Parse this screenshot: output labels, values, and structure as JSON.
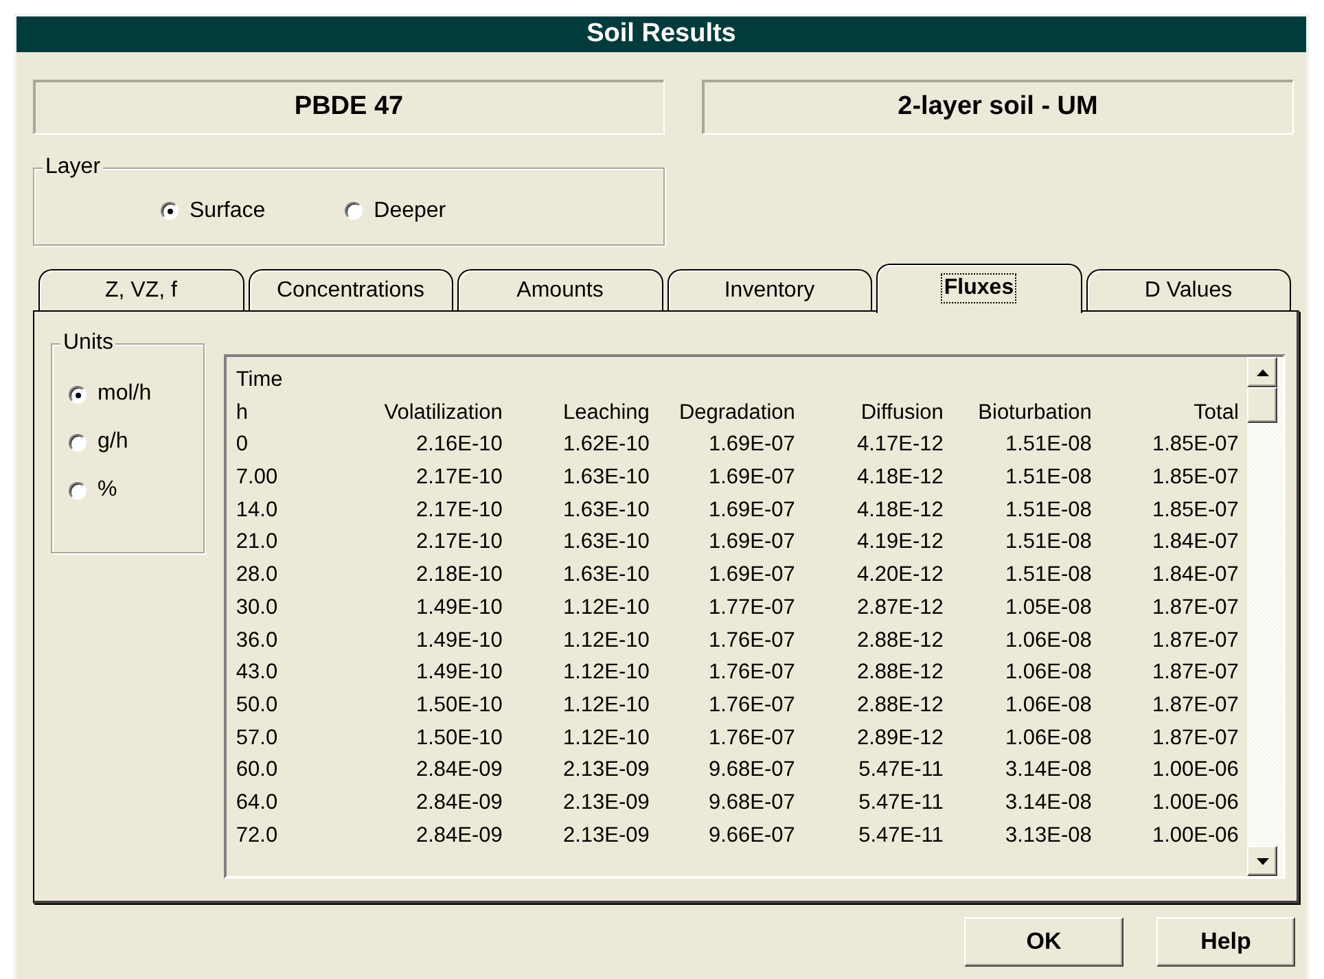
{
  "window": {
    "title": "Soil Results"
  },
  "chemical": "PBDE 47",
  "model": "2-layer soil - UM",
  "layer_group": {
    "label": "Layer",
    "options": [
      {
        "label": "Surface",
        "selected": true
      },
      {
        "label": "Deeper",
        "selected": false
      }
    ]
  },
  "tabs": [
    {
      "label": "Z, VZ, f",
      "selected": false
    },
    {
      "label": "Concentrations",
      "selected": false
    },
    {
      "label": "Amounts",
      "selected": false
    },
    {
      "label": "Inventory",
      "selected": false
    },
    {
      "label": "Fluxes",
      "selected": true
    },
    {
      "label": "D Values",
      "selected": false
    }
  ],
  "units_group": {
    "label": "Units",
    "options": [
      {
        "label": "mol/h",
        "selected": true
      },
      {
        "label": "g/h",
        "selected": false
      },
      {
        "label": "%",
        "selected": false
      }
    ]
  },
  "table": {
    "columns": [
      {
        "title": "Time",
        "label": "h"
      },
      {
        "label": "Volatilization"
      },
      {
        "label": "Leaching"
      },
      {
        "label": "Degradation"
      },
      {
        "label": "Diffusion"
      },
      {
        "label": "Bioturbation"
      },
      {
        "label": "Total"
      }
    ],
    "rows": [
      [
        "0",
        "2.16E-10",
        "1.62E-10",
        "1.69E-07",
        "4.17E-12",
        "1.51E-08",
        "1.85E-07"
      ],
      [
        "7.00",
        "2.17E-10",
        "1.63E-10",
        "1.69E-07",
        "4.18E-12",
        "1.51E-08",
        "1.85E-07"
      ],
      [
        "14.0",
        "2.17E-10",
        "1.63E-10",
        "1.69E-07",
        "4.18E-12",
        "1.51E-08",
        "1.85E-07"
      ],
      [
        "21.0",
        "2.17E-10",
        "1.63E-10",
        "1.69E-07",
        "4.19E-12",
        "1.51E-08",
        "1.84E-07"
      ],
      [
        "28.0",
        "2.18E-10",
        "1.63E-10",
        "1.69E-07",
        "4.20E-12",
        "1.51E-08",
        "1.84E-07"
      ],
      [
        "30.0",
        "1.49E-10",
        "1.12E-10",
        "1.77E-07",
        "2.87E-12",
        "1.05E-08",
        "1.87E-07"
      ],
      [
        "36.0",
        "1.49E-10",
        "1.12E-10",
        "1.76E-07",
        "2.88E-12",
        "1.06E-08",
        "1.87E-07"
      ],
      [
        "43.0",
        "1.49E-10",
        "1.12E-10",
        "1.76E-07",
        "2.88E-12",
        "1.06E-08",
        "1.87E-07"
      ],
      [
        "50.0",
        "1.50E-10",
        "1.12E-10",
        "1.76E-07",
        "2.88E-12",
        "1.06E-08",
        "1.87E-07"
      ],
      [
        "57.0",
        "1.50E-10",
        "1.12E-10",
        "1.76E-07",
        "2.89E-12",
        "1.06E-08",
        "1.87E-07"
      ],
      [
        "60.0",
        "2.84E-09",
        "2.13E-09",
        "9.68E-07",
        "5.47E-11",
        "3.14E-08",
        "1.00E-06"
      ],
      [
        "64.0",
        "2.84E-09",
        "2.13E-09",
        "9.68E-07",
        "5.47E-11",
        "3.14E-08",
        "1.00E-06"
      ],
      [
        "72.0",
        "2.84E-09",
        "2.13E-09",
        "9.66E-07",
        "5.47E-11",
        "3.13E-08",
        "1.00E-06"
      ]
    ]
  },
  "buttons": [
    {
      "label": "OK"
    },
    {
      "label": "Help"
    }
  ]
}
